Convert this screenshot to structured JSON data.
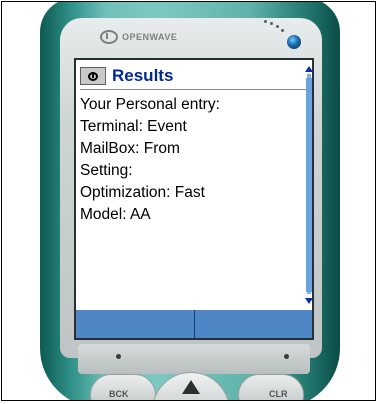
{
  "brand": {
    "name": "OPENWAVE"
  },
  "screen": {
    "title": "Results",
    "lines": [
      "Your Personal entry:",
      "Terminal: Event",
      "MailBox: From",
      "Setting:",
      "Optimization: Fast",
      "Model: AA"
    ]
  },
  "softkeys": {
    "left": "",
    "right": ""
  },
  "keys": {
    "back": "BCK",
    "clear": "CLR"
  },
  "colors": {
    "title": "#002a8c",
    "softkey_bar": "#4f86c6",
    "phone_body": "#5fb3aa"
  },
  "icons": {
    "title_icon": "openwave-logo-icon",
    "led": "led-indicator-icon",
    "scroll_up": "scroll-up-icon",
    "scroll_down": "scroll-down-icon",
    "nav_up": "nav-up-arrow-icon"
  }
}
